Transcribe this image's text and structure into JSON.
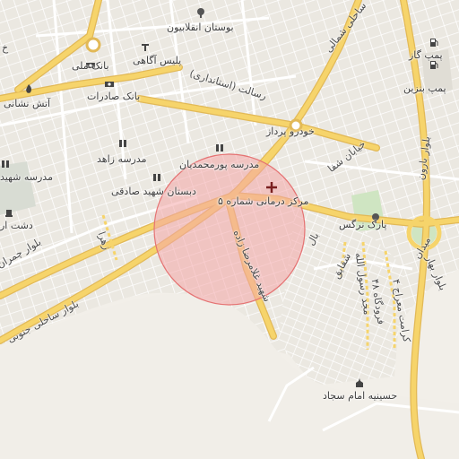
{
  "map": {
    "colors": {
      "land": "#f2efe9",
      "road": "#f6d46b",
      "road_edge": "#e2b957",
      "minor": "#ffffff",
      "block": "#e6e2da",
      "park": "#cfe5c2",
      "radius_fill": "#f4a5a8",
      "radius_stroke": "#e57373",
      "marker": "#7a1f1f"
    },
    "labels": {
      "park_enghelabiyun": "بوستان انقلابیون",
      "pump_gas": "پمپ گاز",
      "pump_gasoline": "پمپ بنزین",
      "bank_melli": "بانک ملی",
      "police_agahi": "پلیس آگاهی",
      "fire_station": "آتش نشانی",
      "bank_saderat": "بانک صادرات",
      "khodro_pardaz": "خودرو پرداز",
      "school_zahed": "مدرسه زاهد",
      "school_pourmohammadian": "مدرسه پورمحمدیان",
      "school_shahid": "مدرسه شهید",
      "dabestan_sadeghi": "دبستان شهید صادقی",
      "clinic_5": "مرکز درمانی شماره ۵",
      "park_narges": "پارک نرگس",
      "dasht": "دشت ار",
      "hosseiniyeh": "حسینیه امام سجاد",
      "kh_left": "خ"
    },
    "roads": {
      "resalat": "رسالت (استانداری)",
      "sahel_shomali": "ساحلی شمالی",
      "khiyaban_shafa": "خیابان شفا",
      "bolvar_chamran": "بلوار چمران",
      "bolvar_sahel_jonubi": "بلوار ساحلی جنوبی",
      "zahra": "زهرا",
      "shahid_gholamreza": "شهید غلامرضا زاده",
      "bahar": "بهار",
      "shaghayegh": "شقایق",
      "majd": "مجد رسول الله",
      "forood": "فرودگاه ۴۸",
      "kermani": "کرامت معراج ۴",
      "bolvar_baroon": "بلوار بارون",
      "meydan": "میدان",
      "bolvar_bahar": "بلوار بهار",
      "bahal": "بال"
    },
    "icons": {
      "park": "tree-icon",
      "fuel": "fuel-pump-icon",
      "bank": "bank-icon",
      "police": "police-icon",
      "fire": "fire-icon",
      "school": "school-icon",
      "clinic": "medical-cross-icon",
      "monument": "monument-icon",
      "mosque": "mosque-icon"
    }
  }
}
